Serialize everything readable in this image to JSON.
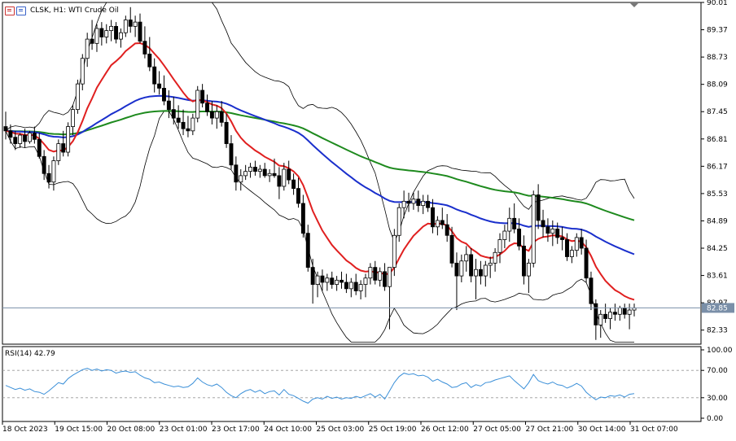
{
  "header": {
    "symbol_text": "CLSK, H1:  WTI Crude Oil",
    "icon_left": "chart-window-icon",
    "icon_right": "chart-properties-icon"
  },
  "rsi_label": "RSI(14) 42.79",
  "colors": {
    "bull_candle": "#000000",
    "bear_candle": "#000000",
    "ma_fast": "#e02020",
    "ma_mid": "#1a2fcc",
    "ma_slow": "#1e8a1e",
    "bands": "#000000",
    "rsi": "#3a8fd8",
    "bid_line": "#7a8fa8"
  },
  "chart_data": [
    {
      "type": "candlestick",
      "title": "",
      "y_ticks": [
        "90.01",
        "89.37",
        "88.73",
        "88.09",
        "87.45",
        "86.81",
        "86.17",
        "85.53",
        "84.89",
        "84.25",
        "83.61",
        "82.97",
        "82.33"
      ],
      "ylim": [
        82.0,
        90.01
      ],
      "x_ticks": [
        "18 Oct 2023",
        "19 Oct 15:00",
        "20 Oct 08:00",
        "23 Oct 01:00",
        "23 Oct 17:00",
        "24 Oct 10:00",
        "25 Oct 03:00",
        "25 Oct 19:00",
        "26 Oct 12:00",
        "27 Oct 05:00",
        "27 Oct 21:00",
        "30 Oct 14:00",
        "31 Oct 07:00"
      ],
      "current_price": "82.85",
      "candles": [
        [
          87.1,
          87.45,
          86.8,
          87.0
        ],
        [
          87.0,
          87.15,
          86.7,
          86.85
        ],
        [
          86.85,
          87.0,
          86.55,
          86.7
        ],
        [
          86.7,
          86.95,
          86.6,
          86.9
        ],
        [
          86.9,
          87.05,
          86.6,
          86.75
        ],
        [
          86.75,
          87.0,
          86.7,
          86.95
        ],
        [
          86.95,
          87.1,
          86.7,
          86.8
        ],
        [
          86.8,
          86.95,
          86.35,
          86.4
        ],
        [
          86.4,
          86.55,
          85.85,
          86.0
        ],
        [
          86.0,
          86.2,
          85.65,
          85.8
        ],
        [
          85.8,
          86.4,
          85.6,
          86.3
        ],
        [
          86.3,
          86.8,
          86.2,
          86.7
        ],
        [
          86.7,
          87.0,
          86.4,
          86.5
        ],
        [
          86.5,
          87.2,
          86.4,
          87.1
        ],
        [
          87.1,
          87.6,
          86.9,
          87.5
        ],
        [
          87.5,
          88.2,
          87.4,
          88.1
        ],
        [
          88.1,
          88.8,
          87.95,
          88.7
        ],
        [
          88.7,
          89.3,
          88.5,
          89.15
        ],
        [
          89.15,
          89.6,
          88.9,
          89.05
        ],
        [
          89.05,
          89.5,
          88.85,
          89.4
        ],
        [
          89.4,
          89.55,
          89.0,
          89.2
        ],
        [
          89.2,
          89.5,
          89.05,
          89.35
        ],
        [
          89.35,
          89.6,
          89.1,
          89.45
        ],
        [
          89.45,
          89.55,
          89.05,
          89.15
        ],
        [
          89.15,
          89.4,
          88.95,
          89.3
        ],
        [
          89.3,
          89.7,
          89.2,
          89.6
        ],
        [
          89.6,
          89.9,
          89.3,
          89.45
        ],
        [
          89.45,
          89.7,
          89.2,
          89.55
        ],
        [
          89.55,
          89.75,
          89.05,
          89.1
        ],
        [
          89.1,
          89.45,
          88.7,
          88.8
        ],
        [
          88.8,
          89.2,
          88.4,
          88.5
        ],
        [
          88.5,
          88.7,
          87.9,
          88.1
        ],
        [
          88.1,
          88.4,
          87.85,
          88.0
        ],
        [
          88.0,
          88.3,
          87.6,
          87.7
        ],
        [
          87.7,
          87.95,
          87.3,
          87.5
        ],
        [
          87.5,
          87.8,
          87.15,
          87.3
        ],
        [
          87.3,
          87.6,
          87.05,
          87.2
        ],
        [
          87.2,
          87.5,
          86.9,
          87.05
        ],
        [
          87.05,
          87.35,
          86.85,
          87.0
        ],
        [
          87.0,
          87.4,
          86.9,
          87.3
        ],
        [
          87.3,
          88.05,
          87.2,
          87.95
        ],
        [
          87.95,
          88.1,
          87.55,
          87.65
        ],
        [
          87.65,
          87.85,
          87.35,
          87.45
        ],
        [
          87.45,
          87.7,
          87.15,
          87.3
        ],
        [
          87.3,
          87.6,
          87.05,
          87.45
        ],
        [
          87.45,
          87.7,
          87.1,
          87.2
        ],
        [
          87.2,
          87.4,
          86.6,
          86.7
        ],
        [
          86.7,
          86.9,
          86.1,
          86.2
        ],
        [
          86.2,
          86.4,
          85.6,
          85.8
        ],
        [
          85.8,
          86.1,
          85.6,
          85.95
        ],
        [
          85.95,
          86.2,
          85.85,
          86.05
        ],
        [
          86.05,
          86.25,
          85.9,
          86.15
        ],
        [
          86.15,
          86.3,
          85.95,
          86.05
        ],
        [
          86.05,
          86.2,
          85.9,
          86.1
        ],
        [
          86.1,
          86.25,
          85.9,
          85.95
        ],
        [
          85.95,
          86.1,
          85.8,
          86.0
        ],
        [
          86.0,
          86.35,
          85.9,
          85.95
        ],
        [
          85.95,
          86.15,
          85.4,
          85.7
        ],
        [
          85.7,
          86.25,
          85.6,
          86.1
        ],
        [
          86.1,
          86.3,
          85.75,
          85.85
        ],
        [
          85.85,
          86.0,
          85.5,
          85.65
        ],
        [
          85.65,
          85.9,
          85.2,
          85.3
        ],
        [
          85.3,
          85.5,
          84.5,
          84.6
        ],
        [
          84.6,
          84.8,
          83.7,
          83.8
        ],
        [
          83.8,
          84.0,
          82.95,
          83.4
        ],
        [
          83.4,
          83.7,
          83.1,
          83.6
        ],
        [
          83.6,
          83.75,
          83.25,
          83.45
        ],
        [
          83.45,
          83.65,
          83.25,
          83.55
        ],
        [
          83.55,
          83.7,
          83.3,
          83.4
        ],
        [
          83.4,
          83.6,
          83.25,
          83.5
        ],
        [
          83.5,
          83.7,
          83.3,
          83.45
        ],
        [
          83.45,
          83.65,
          83.2,
          83.3
        ],
        [
          83.3,
          83.55,
          83.1,
          83.45
        ],
        [
          83.45,
          83.65,
          83.15,
          83.25
        ],
        [
          83.25,
          83.5,
          83.05,
          83.4
        ],
        [
          83.4,
          83.65,
          83.1,
          83.55
        ],
        [
          83.55,
          83.9,
          83.4,
          83.8
        ],
        [
          83.8,
          83.95,
          83.4,
          83.5
        ],
        [
          83.5,
          83.8,
          83.35,
          83.7
        ],
        [
          83.7,
          83.9,
          83.25,
          83.35
        ],
        [
          83.35,
          83.5,
          82.35,
          83.8
        ],
        [
          83.8,
          84.7,
          83.6,
          84.55
        ],
        [
          84.55,
          85.3,
          84.4,
          85.2
        ],
        [
          85.2,
          85.6,
          84.95,
          85.35
        ],
        [
          85.35,
          85.55,
          85.1,
          85.3
        ],
        [
          85.3,
          85.55,
          85.15,
          85.4
        ],
        [
          85.4,
          85.6,
          85.1,
          85.25
        ],
        [
          85.25,
          85.5,
          85.05,
          85.35
        ],
        [
          85.35,
          85.5,
          85.1,
          85.2
        ],
        [
          85.2,
          85.4,
          84.6,
          84.75
        ],
        [
          84.75,
          85.0,
          84.55,
          84.9
        ],
        [
          84.9,
          85.2,
          84.7,
          84.8
        ],
        [
          84.8,
          85.05,
          84.4,
          84.55
        ],
        [
          84.55,
          84.75,
          83.8,
          83.9
        ],
        [
          83.9,
          84.15,
          82.8,
          83.6
        ],
        [
          83.6,
          84.1,
          83.45,
          83.95
        ],
        [
          83.95,
          84.3,
          83.7,
          84.1
        ],
        [
          84.1,
          84.25,
          83.45,
          83.6
        ],
        [
          83.6,
          84.0,
          83.05,
          83.75
        ],
        [
          83.75,
          83.95,
          83.4,
          83.6
        ],
        [
          83.6,
          83.95,
          83.35,
          83.85
        ],
        [
          83.85,
          84.05,
          83.55,
          83.9
        ],
        [
          83.9,
          84.25,
          83.7,
          84.15
        ],
        [
          84.15,
          84.6,
          83.9,
          84.45
        ],
        [
          84.45,
          84.8,
          84.25,
          84.65
        ],
        [
          84.65,
          85.2,
          84.4,
          84.95
        ],
        [
          84.95,
          85.3,
          84.6,
          84.7
        ],
        [
          84.7,
          84.95,
          84.2,
          84.3
        ],
        [
          84.3,
          84.55,
          83.4,
          83.6
        ],
        [
          83.6,
          84.0,
          83.2,
          83.9
        ],
        [
          83.9,
          85.6,
          83.8,
          85.5
        ],
        [
          85.5,
          85.75,
          84.7,
          84.9
        ],
        [
          84.9,
          85.15,
          84.5,
          84.75
        ],
        [
          84.75,
          84.95,
          84.4,
          84.6
        ],
        [
          84.6,
          84.9,
          84.3,
          84.7
        ],
        [
          84.7,
          84.85,
          84.35,
          84.5
        ],
        [
          84.5,
          84.75,
          84.2,
          84.45
        ],
        [
          84.45,
          84.6,
          83.95,
          84.05
        ],
        [
          84.05,
          84.3,
          83.9,
          84.2
        ],
        [
          84.2,
          84.6,
          84.05,
          84.5
        ],
        [
          84.5,
          84.7,
          84.1,
          84.25
        ],
        [
          84.25,
          84.45,
          83.45,
          83.55
        ],
        [
          83.55,
          83.7,
          82.8,
          82.95
        ],
        [
          82.95,
          83.05,
          82.1,
          82.45
        ],
        [
          82.45,
          82.8,
          82.15,
          82.7
        ],
        [
          82.7,
          82.95,
          82.5,
          82.6
        ],
        [
          82.6,
          82.85,
          82.35,
          82.75
        ],
        [
          82.75,
          82.95,
          82.55,
          82.7
        ],
        [
          82.7,
          82.9,
          82.55,
          82.85
        ],
        [
          82.85,
          82.95,
          82.6,
          82.7
        ],
        [
          82.7,
          82.95,
          82.35,
          82.8
        ],
        [
          82.8,
          82.95,
          82.65,
          82.85
        ]
      ],
      "rsi": {
        "label": "RSI(14) 42.79",
        "y_ticks": [
          "100.00",
          "70.00",
          "30.00",
          "0.00"
        ],
        "levels": [
          70,
          30
        ],
        "values": [
          48,
          45,
          42,
          44,
          41,
          43,
          39,
          38,
          35,
          40,
          46,
          52,
          50,
          58,
          63,
          67,
          71,
          73,
          70,
          72,
          69,
          71,
          70,
          66,
          68,
          69,
          67,
          68,
          63,
          59,
          57,
          52,
          53,
          50,
          48,
          46,
          47,
          45,
          46,
          51,
          59,
          53,
          49,
          47,
          50,
          45,
          38,
          33,
          30,
          36,
          40,
          42,
          38,
          41,
          36,
          39,
          40,
          34,
          42,
          35,
          33,
          29,
          25,
          22,
          28,
          30,
          28,
          32,
          29,
          31,
          28,
          30,
          29,
          32,
          30,
          33,
          36,
          31,
          35,
          28,
          40,
          52,
          61,
          66,
          64,
          65,
          62,
          63,
          60,
          54,
          57,
          53,
          50,
          45,
          46,
          50,
          52,
          45,
          49,
          47,
          52,
          53,
          56,
          58,
          60,
          62,
          55,
          49,
          43,
          52,
          64,
          55,
          52,
          50,
          53,
          49,
          48,
          44,
          47,
          51,
          47,
          38,
          32,
          27,
          31,
          30,
          33,
          32,
          34,
          31,
          35,
          36
        ]
      }
    }
  ]
}
